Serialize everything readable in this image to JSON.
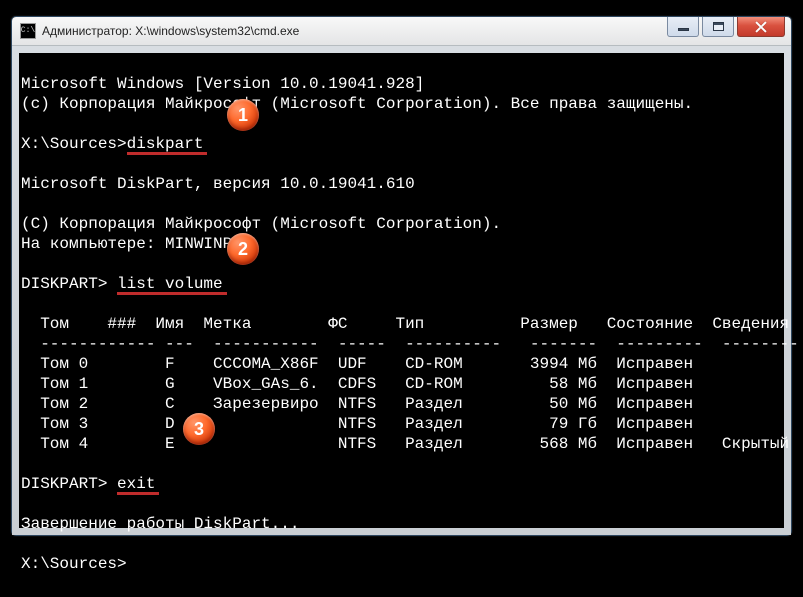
{
  "window": {
    "title": "Администратор: X:\\windows\\system32\\cmd.exe",
    "sysicon_text": "C:\\"
  },
  "lines": {
    "l0": "Microsoft Windows [Version 10.0.19041.928]",
    "l1": "(c) Корпорация Майкрософт (Microsoft Corporation). Все права защищены.",
    "empty": "",
    "p1a": "X:\\Sources>",
    "p1b": "diskpart",
    "l4": "Microsoft DiskPart, версия 10.0.19041.610",
    "l5": "(C) Корпорация Майкрософт (Microsoft Corporation).",
    "l6": "На компьютере: MINWINPC",
    "p2a": "DISKPART> ",
    "p2b": "list volume",
    "hdr": "  Том    ###  Имя  Метка        ФС     Тип          Размер   Состояние  Сведения",
    "sep": "  ------------ ---  -----------  -----  ----------   -------  ---------  --------",
    "r0": "  Том 0        F    CCCOMA_X86F  UDF    CD-ROM       3994 Мб  Исправен",
    "r1": "  Том 1        G    VBox_GAs_6.  CDFS   CD-ROM         58 Мб  Исправен",
    "r2": "  Том 2        C    Зарезервиро  NTFS   Раздел         50 Мб  Исправен",
    "r3": "  Том 3        D                 NTFS   Раздел         79 Гб  Исправен",
    "r4": "  Том 4        E                 NTFS   Раздел        568 Мб  Исправен   Скрытый",
    "p3a": "DISKPART> ",
    "p3b": "exit",
    "l20": "Завершение работы DiskPart...",
    "p4": "X:\\Sources>"
  },
  "badges": {
    "b1": "1",
    "b2": "2",
    "b3": "3"
  }
}
